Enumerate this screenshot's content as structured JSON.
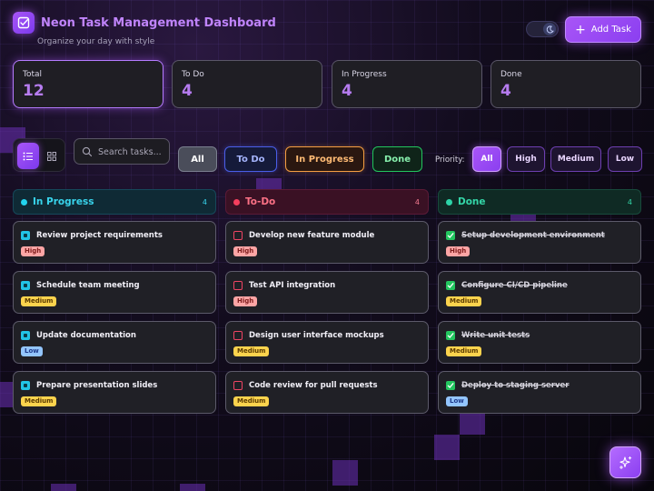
{
  "header": {
    "title": "Neon Task Management Dashboard",
    "subtitle": "Organize your day with style",
    "add_task_label": "Add Task",
    "theme_toggle_icon": "moon-icon"
  },
  "stats": [
    {
      "label": "Total",
      "value": "12"
    },
    {
      "label": "To Do",
      "value": "4"
    },
    {
      "label": "In Progress",
      "value": "4"
    },
    {
      "label": "Done",
      "value": "4"
    }
  ],
  "toolbar": {
    "search_placeholder": "Search tasks...",
    "status_filters": [
      "All",
      "To Do",
      "In Progress",
      "Done"
    ],
    "priority_label": "Priority:",
    "priority_filters": [
      "All",
      "High",
      "Medium",
      "Low"
    ],
    "active_status_filter": "All",
    "active_priority_filter": "All",
    "active_view": "list"
  },
  "columns": [
    {
      "title": "In Progress",
      "count": "4",
      "color": "#22d3ee",
      "tasks": [
        {
          "title": "Review project requirements",
          "priority": "High"
        },
        {
          "title": "Schedule team meeting",
          "priority": "Medium"
        },
        {
          "title": "Update documentation",
          "priority": "Low"
        },
        {
          "title": "Prepare presentation slides",
          "priority": "Medium"
        }
      ]
    },
    {
      "title": "To-Do",
      "count": "4",
      "color": "#f43f5e",
      "tasks": [
        {
          "title": "Develop new feature module",
          "priority": "High"
        },
        {
          "title": "Test API integration",
          "priority": "High"
        },
        {
          "title": "Design user interface mockups",
          "priority": "Medium"
        },
        {
          "title": "Code review for pull requests",
          "priority": "Medium"
        }
      ]
    },
    {
      "title": "Done",
      "count": "4",
      "color": "#2dd4a8",
      "tasks": [
        {
          "title": "Setup development environment",
          "priority": "High"
        },
        {
          "title": "Configure CI/CD pipeline",
          "priority": "Medium"
        },
        {
          "title": "Write unit tests",
          "priority": "Medium"
        },
        {
          "title": "Deploy to staging server",
          "priority": "Low"
        }
      ]
    }
  ],
  "colors": {
    "accent": "#a855f7",
    "in_progress": "#22d3ee",
    "todo": "#f43f5e",
    "done": "#22c55e",
    "priority_high": "#fca5a5",
    "priority_medium": "#fcd34d",
    "priority_low": "#93c5fd"
  }
}
